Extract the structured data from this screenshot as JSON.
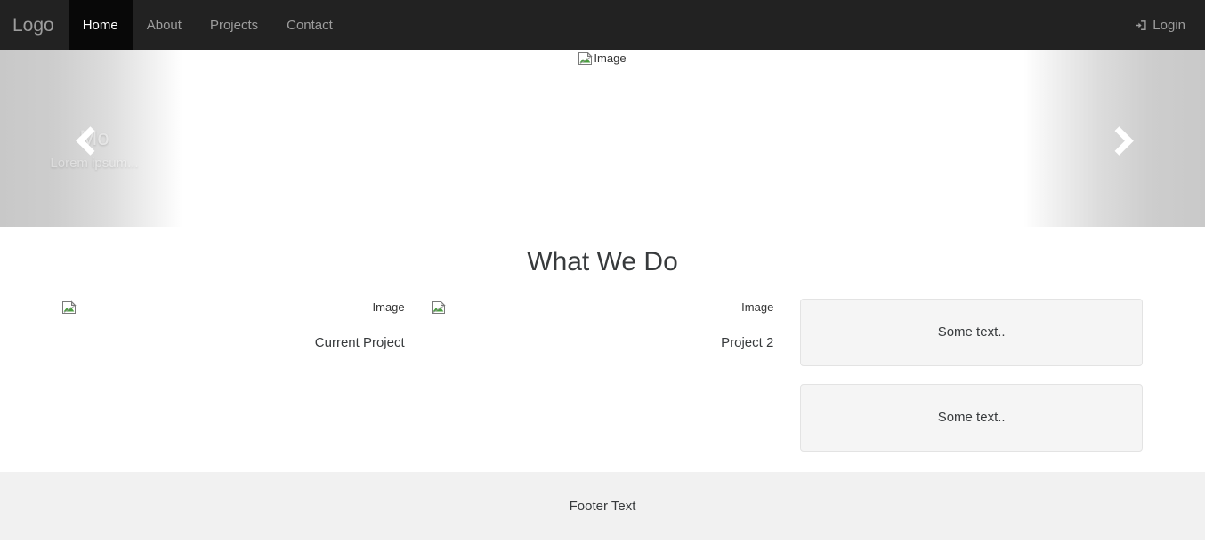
{
  "navbar": {
    "brand": "Logo",
    "items": [
      {
        "label": "Home",
        "active": true
      },
      {
        "label": "About",
        "active": false
      },
      {
        "label": "Projects",
        "active": false
      },
      {
        "label": "Contact",
        "active": false
      }
    ],
    "login": {
      "label": "Login",
      "icon": "sign-in-icon"
    },
    "colors": {
      "background": "#222222",
      "active_background": "#080808",
      "link": "#9d9d9d",
      "active_link": "#ffffff"
    }
  },
  "carousel": {
    "slide_image_alt": "Image",
    "slide_image_icon": "broken-image-icon",
    "caption": {
      "heading": "Mo",
      "text": "Lorem ipsum..."
    },
    "prev_control": "‹",
    "next_control": "›",
    "prev_icon": "chevron-left-icon",
    "next_icon": "chevron-right-icon"
  },
  "main": {
    "heading": "What We Do",
    "projects": [
      {
        "image_alt": "Image",
        "image_icon": "broken-image-icon",
        "caption": "Current Project"
      },
      {
        "image_alt": "Image",
        "image_icon": "broken-image-icon",
        "caption": "Project 2"
      }
    ],
    "wells": [
      {
        "text": "Some text.."
      },
      {
        "text": "Some text.."
      }
    ]
  },
  "footer": {
    "text": "Footer Text",
    "background": "#f1f1f1"
  }
}
